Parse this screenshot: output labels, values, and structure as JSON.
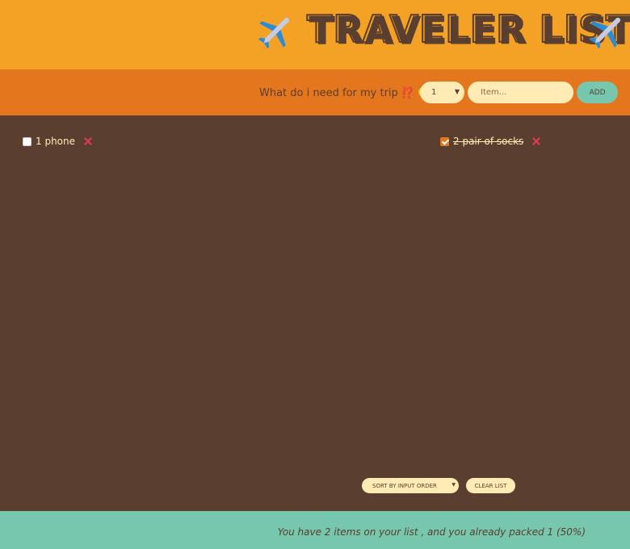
{
  "header": {
    "title": "TRAVELER LIST",
    "left_icon": "airplane-icon",
    "right_icon": "airplane-icon"
  },
  "form": {
    "question": "What do i need for my trip ⁉️",
    "emoji_icon": "flushed-face-icon",
    "quantity_value": "1",
    "item_placeholder": "Item...",
    "add_label": "ADD"
  },
  "list": {
    "items": [
      {
        "label": "1 phone",
        "packed": false
      },
      {
        "label": "2 pair of socks",
        "packed": true
      }
    ],
    "delete_icon": "close-icon"
  },
  "actions": {
    "sort_value": "SORT BY INPUT ORDER",
    "clear_label": "CLEAR LIST"
  },
  "stats": {
    "text": "You have 2 items on your list , and you already packed 1 (50%)"
  },
  "colors": {
    "header_bg": "#f4a226",
    "form_bg": "#e4761e",
    "list_bg": "#5a3e2f",
    "stats_bg": "#76c7ad",
    "text_light": "#ffebb3",
    "delete": "#e23b4f"
  }
}
